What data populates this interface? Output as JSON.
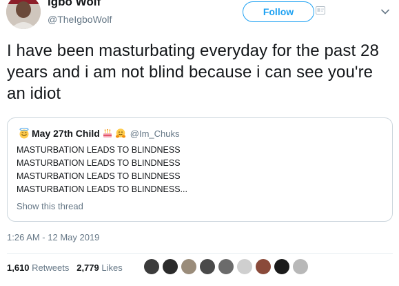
{
  "tweet": {
    "author_name": "Igbo Wolf",
    "author_handle": "@TheIgboWolf",
    "follow_label": "Follow",
    "text": "I have been masturbating everyday for the past 28 years and i am not blind because i can see you're an idiot",
    "timestamp": "1:26 AM - 12 May 2019"
  },
  "quoted": {
    "name": "May 27th Child",
    "handle": "@Im_Chuks",
    "name_prefix_icon": "angel-smile-emoji",
    "name_suffix_icons": [
      "birthday-cake-emoji",
      "hugging-face-emoji"
    ],
    "lines": [
      "MASTURBATION LEADS TO BLINDNESS",
      "MASTURBATION LEADS TO BLINDNESS",
      "MASTURBATION LEADS TO BLINDNESS",
      "MASTURBATION LEADS TO BLINDNESS..."
    ],
    "show_thread": "Show this thread"
  },
  "stats": {
    "retweets_count": "1,610",
    "retweets_label": "Retweets",
    "likes_count": "2,779",
    "likes_label": "Likes"
  },
  "likers": [
    "#3b3b3b",
    "#2b2b2b",
    "#9a8c7a",
    "#4a4a4a",
    "#6b6b6b",
    "#cfcfcf",
    "#8a4a3a",
    "#1a1a1a",
    "#b8b8b8"
  ],
  "colors": {
    "accent": "#1da1f2",
    "secondary_text": "#657786",
    "border": "#ccd6dd"
  }
}
